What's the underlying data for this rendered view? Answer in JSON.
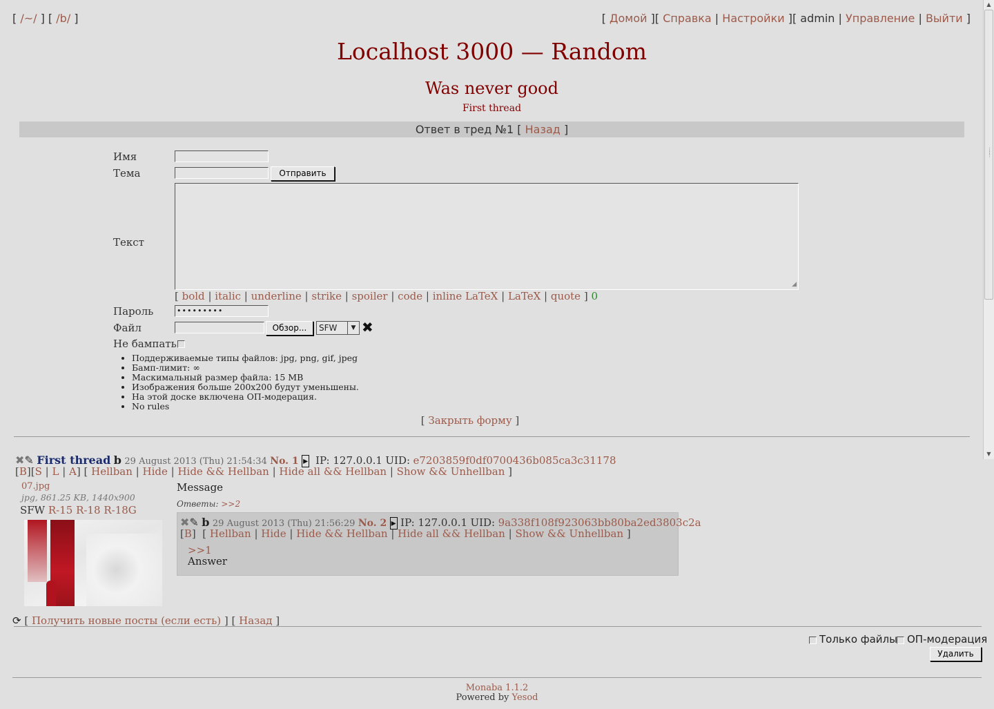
{
  "nav": {
    "left": [
      "/~/",
      "/b/"
    ],
    "right": [
      "Домой",
      "Справка",
      "Настройки",
      "admin",
      "Управление",
      "Выйти"
    ]
  },
  "board_title": "Localhost 3000 — Random",
  "thread": {
    "subject": "Was never good",
    "subtitle": "First thread"
  },
  "reply_bar": {
    "text": "Ответ в тред №1",
    "back_label": "Назад"
  },
  "form": {
    "name_label": "Имя",
    "subject_label": "Тема",
    "submit_label": "Отправить",
    "text_label": "Текст",
    "name_value": "",
    "subject_value": "",
    "markup": [
      "bold",
      "italic",
      "underline",
      "strike",
      "spoiler",
      "code",
      "inline LaTeX",
      "LaTeX",
      "quote"
    ],
    "char_count": "0",
    "password_label": "Пароль",
    "password_value": "•••••••••",
    "file_label": "Файл",
    "browse_label": "Обзор...",
    "rating_value": "SFW",
    "nobump_label": "Не бампать",
    "rules": [
      "Поддерживаемые типы файлов: jpg, png, gif, jpeg",
      "Бамп-лимит: ∞",
      "Маскимальный размер файла: 15 MB",
      "Изображения больше 200x200 будут уменьшены.",
      "На этой доске включена ОП-модерация.",
      "No rules"
    ],
    "close_label": "Закрыть форму"
  },
  "op_post": {
    "subject": "First thread",
    "name": "b",
    "date": "29 August 2013 (Thu) 21:54:34",
    "number": "No. 1",
    "ip": "IP: 127.0.0.1",
    "uid_label": "UID:",
    "uid": "e7203859f0df0700436b085ca3c31178",
    "flags": [
      "B",
      "S",
      "L",
      "A"
    ],
    "actions": [
      "Hellban",
      "Hide",
      "Hide && Hellban",
      "Hide all && Hellban",
      "Show && Unhellban"
    ],
    "file": {
      "name": "07.jpg",
      "info": "jpg, 861.25 KB, 1440x900",
      "rating": "SFW",
      "rating_links": [
        "R-15",
        "R-18",
        "R-18G"
      ]
    },
    "message": "Message",
    "replies_label": "Ответы:",
    "replies": [
      ">>2"
    ]
  },
  "reply_post": {
    "name": "b",
    "date": "29 August 2013 (Thu) 21:56:29",
    "number": "No. 2",
    "ip": "IP: 127.0.0.1",
    "uid_label": "UID:",
    "uid": "9a338f108f923063bb80ba2ed3803c2a",
    "flags": [
      "B"
    ],
    "actions": [
      "Hellban",
      "Hide",
      "Hide && Hellban",
      "Hide all && Hellban",
      "Show && Unhellban"
    ],
    "quote": ">>1",
    "text": "Answer"
  },
  "bottom": {
    "get_new_label": "Получить новые посты (если есть)",
    "back_label": "Назад",
    "only_files_label": "Только файлы",
    "op_mod_label": "ОП-модерация",
    "delete_label": "Удалить"
  },
  "footer": {
    "engine": "Monaba 1.1.2",
    "powered_by": "Powered by",
    "framework": "Yesod"
  },
  "colors": {
    "background": "#e0e0e0",
    "title": "#800000",
    "link": "#9c5a4a",
    "bar": "#c8c8c8"
  },
  "icons": [
    "refresh-icon",
    "delete-post-icon",
    "edit-post-icon",
    "expand-icon",
    "clear-file-icon"
  ]
}
